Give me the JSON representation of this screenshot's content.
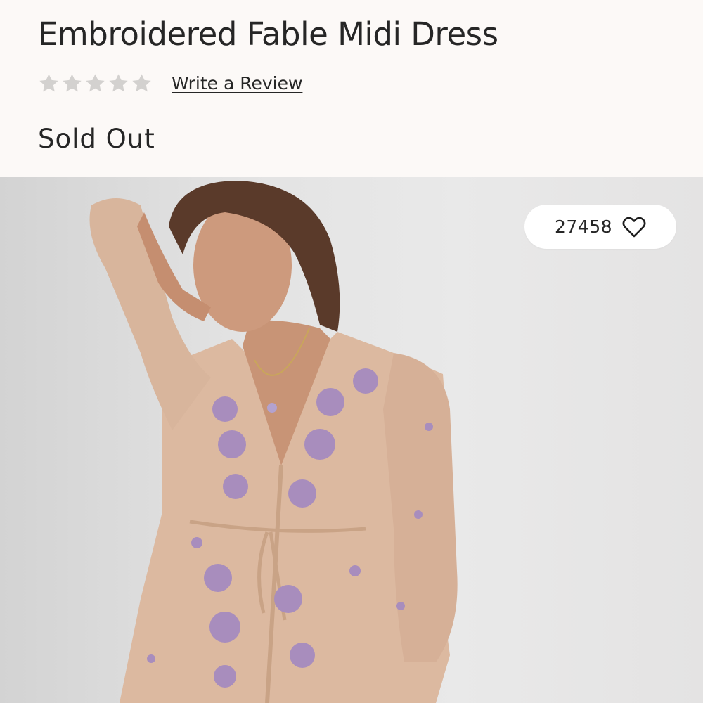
{
  "product": {
    "title": "Embroidered Fable Midi Dress",
    "rating": {
      "value": 0,
      "max": 5,
      "star_color": "#d3d1cf"
    },
    "review_link": "Write a Review",
    "status": "Sold Out"
  },
  "gallery": {
    "image_icon": "product-photo",
    "favorites": {
      "count": "27458",
      "icon": "heart-outline-icon"
    }
  },
  "colors": {
    "page_background": "#fcf9f7",
    "text": "#262626",
    "dress": "#dcb9a0",
    "embroidery": "#a88dbd"
  }
}
